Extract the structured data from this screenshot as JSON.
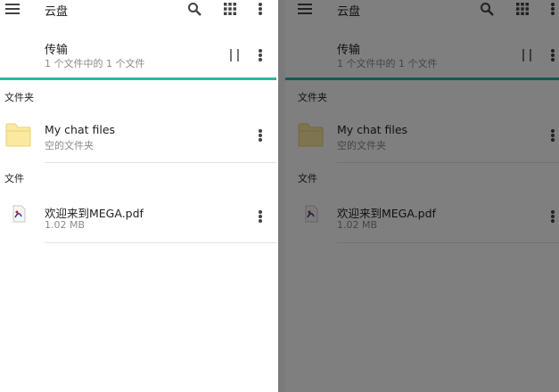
{
  "toolbar": {
    "title": "云盘"
  },
  "transfer": {
    "title": "传输",
    "subtitle": "1 个文件中的 1 个文件",
    "progress": 1.0
  },
  "sections": {
    "folders": "文件夹",
    "files": "文件"
  },
  "folders": [
    {
      "name": "My chat files",
      "detail": "空的文件夹"
    }
  ],
  "files": [
    {
      "name": "欢迎来到MEGA.pdf",
      "size": "1.02 MB"
    }
  ],
  "colors": {
    "accent": "#26b8a0",
    "overlay": "rgba(0,0,0,0.5)",
    "folder": "#fce9a0"
  },
  "icons": [
    "menu-icon",
    "search-icon",
    "grid-icon",
    "more-vert-icon",
    "pause-icon",
    "folder-icon",
    "pdf-icon"
  ]
}
